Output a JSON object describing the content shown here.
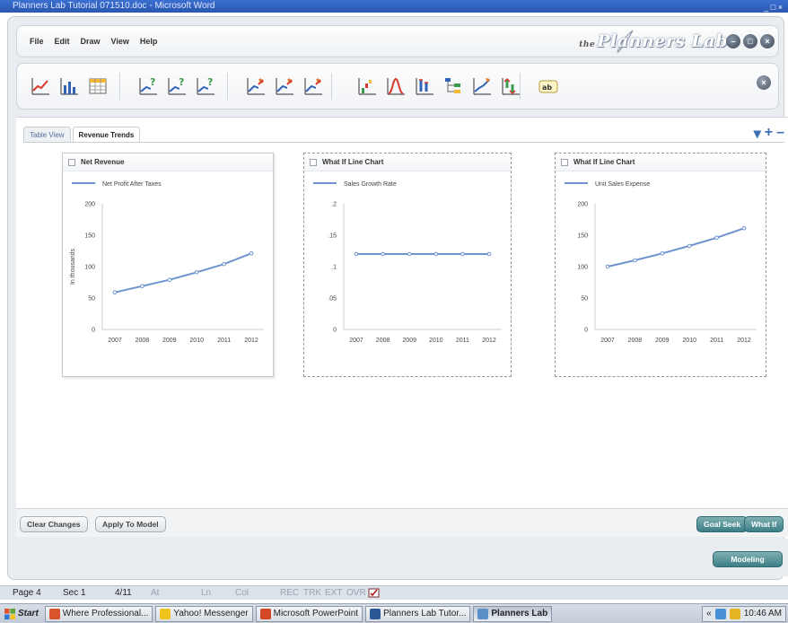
{
  "window": {
    "title": "Planners Lab Tutorial 071510.doc - Microsoft Word",
    "controls": "_ □ ×"
  },
  "app": {
    "brand_prefix": "the",
    "brand": "Planners Lab",
    "menu": [
      "File",
      "Edit",
      "Draw",
      "View",
      "Help"
    ],
    "window_buttons": [
      "–",
      "□",
      "×"
    ]
  },
  "toolbar": {
    "icons": [
      "line-chart-icon",
      "bar-chart-icon",
      "table-icon",
      "what-if-line-icon",
      "what-if-bar-icon",
      "what-if-table-icon",
      "goal-seek-line-icon",
      "goal-seek-bar-icon",
      "goal-seek-table-icon",
      "waterfall-icon",
      "distribution-icon",
      "range-icon",
      "tree-icon",
      "trend-icon",
      "sensitivity-icon",
      "text-label-icon"
    ],
    "close_label": "×"
  },
  "tabs": [
    {
      "label": "Table View",
      "active": false
    },
    {
      "label": "Revenue Trends",
      "active": true
    }
  ],
  "view_controls": {
    "dropdown": "▾",
    "add": "+",
    "remove": "–"
  },
  "charts": [
    {
      "title": "Net Revenue",
      "legend": "Net Profit After Taxes",
      "ylabel": "In thousands",
      "yticks": [
        "200",
        "150",
        "100",
        "50",
        "0"
      ],
      "yvals": [
        200,
        150,
        100,
        50,
        0
      ],
      "ymax": 200,
      "x": [
        "2007",
        "2008",
        "2009",
        "2010",
        "2011",
        "2012"
      ],
      "values": [
        59,
        69,
        79,
        91,
        104,
        121
      ],
      "dashed": false,
      "color": "#6f93cf"
    },
    {
      "title": "What If Line Chart",
      "legend": "Sales Growth Rate",
      "ylabel": "",
      "yticks": [
        ".2",
        ".15",
        ".1",
        ".05",
        "0"
      ],
      "yvals": [
        0.2,
        0.15,
        0.1,
        0.05,
        0
      ],
      "ymax": 0.2,
      "x": [
        "2007",
        "2008",
        "2009",
        "2010",
        "2011",
        "2012"
      ],
      "values": [
        0.12,
        0.12,
        0.12,
        0.12,
        0.12,
        0.12
      ],
      "dashed": true,
      "color": "#6f93cf"
    },
    {
      "title": "What If Line Chart",
      "legend": "Unit Sales Expense",
      "ylabel": "",
      "yticks": [
        "200",
        "150",
        "100",
        "50",
        "0"
      ],
      "yvals": [
        200,
        150,
        100,
        50,
        0
      ],
      "ymax": 200,
      "x": [
        "2007",
        "2008",
        "2009",
        "2010",
        "2011",
        "2012"
      ],
      "values": [
        100,
        110,
        121,
        133,
        146,
        161
      ],
      "dashed": true,
      "color": "#6f93cf"
    }
  ],
  "chart_data": [
    {
      "type": "line",
      "title": "Net Revenue",
      "x": [
        "2007",
        "2008",
        "2009",
        "2010",
        "2011",
        "2012"
      ],
      "series": [
        {
          "name": "Net Profit After Taxes",
          "values": [
            59,
            69,
            79,
            91,
            104,
            121
          ]
        }
      ],
      "ylabel": "In thousands",
      "ylim": [
        0,
        200
      ],
      "legend": "top-left"
    },
    {
      "type": "line",
      "title": "What If Line Chart",
      "x": [
        "2007",
        "2008",
        "2009",
        "2010",
        "2011",
        "2012"
      ],
      "series": [
        {
          "name": "Sales Growth Rate",
          "values": [
            0.12,
            0.12,
            0.12,
            0.12,
            0.12,
            0.12
          ]
        }
      ],
      "ylim": [
        0,
        0.2
      ],
      "legend": "top-left"
    },
    {
      "type": "line",
      "title": "What If Line Chart",
      "x": [
        "2007",
        "2008",
        "2009",
        "2010",
        "2011",
        "2012"
      ],
      "series": [
        {
          "name": "Unit Sales Expense",
          "values": [
            100,
            110,
            121,
            133,
            146,
            161
          ]
        }
      ],
      "ylim": [
        0,
        200
      ],
      "legend": "top-left"
    }
  ],
  "buttons": {
    "clear_changes": "Clear Changes",
    "apply_to_model": "Apply To Model",
    "goal_seek": "Goal Seek",
    "what_if": "What If",
    "modeling": "Modeling"
  },
  "statusbar": {
    "page": "Page 4",
    "sec": "Sec 1",
    "pages": "4/11",
    "at": "At",
    "ln": "Ln",
    "col": "Col",
    "rec": "REC",
    "trk": "TRK",
    "ext": "EXT",
    "ovr": "OVR"
  },
  "taskbar": {
    "start": "Start",
    "tasks": [
      {
        "label": "Where Professional...",
        "active": false
      },
      {
        "label": "Yahoo! Messenger",
        "active": false
      },
      {
        "label": "Microsoft PowerPoint",
        "active": false
      },
      {
        "label": "Planners Lab Tutor...",
        "active": false
      },
      {
        "label": "Planners Lab",
        "active": true
      }
    ],
    "tray_arrow": "«",
    "clock": "10:46 AM"
  }
}
